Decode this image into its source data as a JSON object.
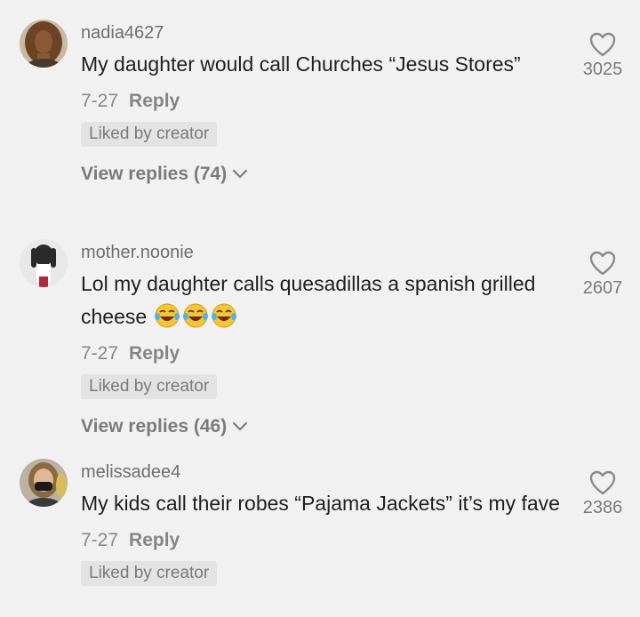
{
  "comments": [
    {
      "username": "nadia4627",
      "text": "My daughter would call Churches “Jesus Stores”",
      "date": "7-27",
      "reply_label": "Reply",
      "badge": "Liked by creator",
      "view_replies": "View replies (74)",
      "likes": "3025",
      "avatar": "avatar-woman-curly-hair"
    },
    {
      "username": "mother.noonie",
      "text": "Lol my daughter calls quesadillas a spanish grilled cheese",
      "emojis": [
        "face-with-tears-of-joy",
        "face-with-tears-of-joy",
        "face-with-tears-of-joy"
      ],
      "date": "7-27",
      "reply_label": "Reply",
      "badge": "Liked by creator",
      "view_replies": "View replies (46)",
      "likes": "2607",
      "avatar": "avatar-dark-figure"
    },
    {
      "username": "melissadee4",
      "text": "My kids call their robes “Pajama Jackets” it’s my fave",
      "date": "7-27",
      "reply_label": "Reply",
      "badge": "Liked by creator",
      "likes": "2386",
      "avatar": "avatar-woman-face-mask"
    }
  ],
  "colors": {
    "background": "#f1f1f1",
    "text": "#1f1f1f",
    "muted": "#7a7a7a",
    "badge_bg": "#e3e3e3"
  }
}
